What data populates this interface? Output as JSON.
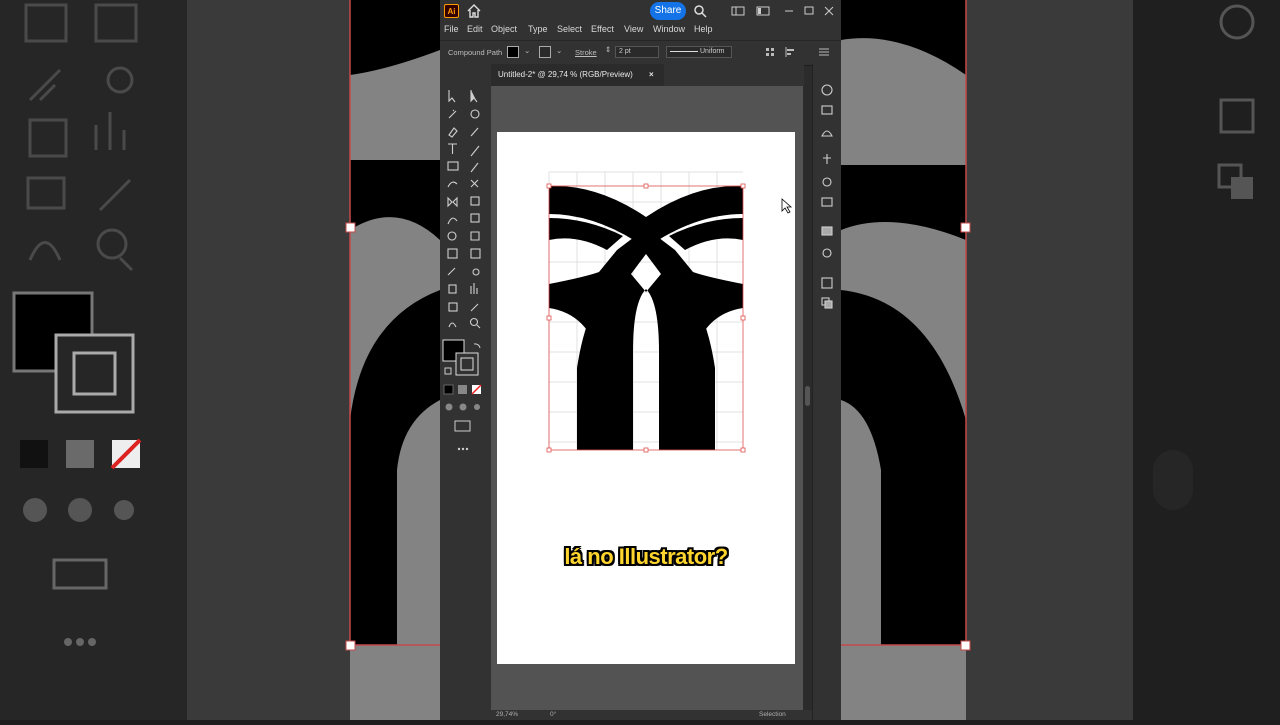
{
  "app": {
    "logo": "Ai",
    "share_label": "Share",
    "icons": [
      "home-icon",
      "search-icon",
      "arrange-documents-icon",
      "panel-layout-icon",
      "minimize-icon",
      "maximize-icon",
      "close-icon"
    ]
  },
  "menu": {
    "items": [
      "File",
      "Edit",
      "Object",
      "Type",
      "Select",
      "Effect",
      "View",
      "Window",
      "Help"
    ]
  },
  "control_bar": {
    "selection_type": "Compound Path",
    "stroke_label": "Stroke",
    "stroke_weight": "2 pt",
    "stroke_profile": "Uniform"
  },
  "document": {
    "tab_title": "Untitled-2* @ 29,74 % (RGB/Preview)",
    "close_symbol": "×"
  },
  "status_bar": {
    "zoom": "29,74%",
    "rotation": "0°",
    "tool_name": "Selection"
  },
  "caption": {
    "text": "lá no Illustrator?"
  },
  "colors": {
    "accent": "#1473e6",
    "caption": "#ffd52e",
    "artboard": "#ffffff",
    "selection": "#e05050"
  }
}
